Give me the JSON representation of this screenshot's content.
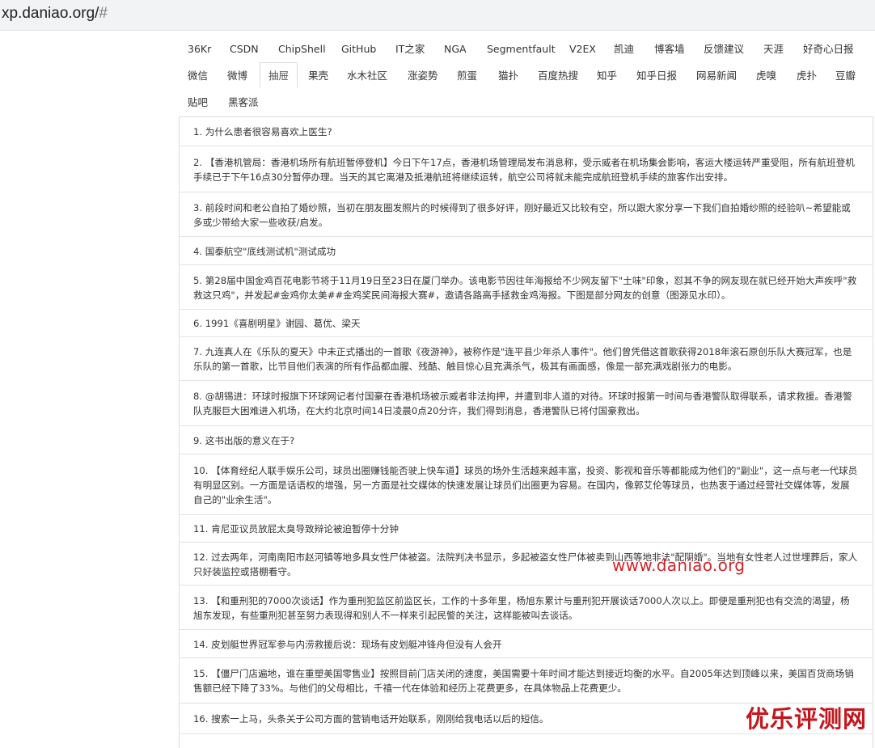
{
  "browser": {
    "url": "xp.daniao.org/",
    "url_hash": "#"
  },
  "tabs_row1": [
    "36Kr",
    "CSDN",
    "ChipShell",
    "GitHub",
    "IT之家",
    "NGA",
    "Segmentfault",
    "V2EX",
    "凯迪",
    "博客墙",
    "反馈建议",
    "天涯",
    "好奇心日报"
  ],
  "tabs_row2": [
    "微信",
    "微博",
    "抽屉",
    "果壳",
    "水木社区",
    "涨姿势",
    "煎蛋",
    "猫扑",
    "百度热搜",
    "知乎",
    "知乎日报",
    "网易新闻",
    "虎嗅",
    "虎扑",
    "豆瓣"
  ],
  "tabs_row3": [
    "贴吧",
    "黑客派"
  ],
  "active_tab": "抽屉",
  "items": [
    "1. 为什么患者很容易喜欢上医生?",
    "2. 【香港机管局：香港机场所有航班暂停登机】今日下午17点，香港机场管理局发布消息称，受示威者在机场集会影响，客运大楼运转严重受阻，所有航班登机手续已于下午16点30分暂停办理。当天的其它离港及抵港航班将继续运转，航空公司将就未能完成航班登机手续的旅客作出安排。",
    "3. 前段时间和老公自拍了婚纱照，当初在朋友圈发照片的时候得到了很多好评，刚好最近又比较有空，所以跟大家分享一下我们自拍婚纱照的经验叭~希望能或多或少带给大家一些收获/启发。",
    "4. 国泰航空\"底线测试机\"测试成功",
    "5. 第28届中国金鸡百花电影节将于11月19日至23日在厦门举办。该电影节因往年海报给不少网友留下\"土味\"印象，怼其不争的网友现在就已经开始大声疾呼\"救救这只鸡\"，并发起#金鸡你太美##金鸡奖民间海报大赛#，邀请各路高手拯救金鸡海报。下图是部分网友的创意（图源见水印）。",
    "6. 1991《喜剧明星》谢园、葛优、梁天",
    "7. 九连真人在《乐队的夏天》中未正式播出的一首歌《夜游神》，被称作是\"连平县少年杀人事件\"。他们曾凭借这首歌获得2018年滚石原创乐队大赛冠军，也是乐队的第一首歌，比节目他们表演的所有作品都血腥、残酷、触目惊心且充满杀气，极其有画面感，像是一部充满戏剧张力的电影。",
    "8. @胡锡进：环球时报旗下环球网记者付国豪在香港机场被示威者非法拘押，并遭到非人道的对待。环球时报第一时间与香港警队取得联系，请求救援。香港警队克服巨大困难进入机场，在大约北京时间14日凌晨0点20分许，我们得到消息，香港警队已将付国豪救出。",
    "9. 这书出版的意义在于?",
    "10. 【体育经纪人联手娱乐公司，球员出圈赚钱能否驶上快车道】球员的场外生活越来越丰富，投资、影视和音乐等都能成为他们的\"副业\"，这一点与老一代球员有明显区别。一方面是话语权的增强，另一方面是社交媒体的快速发展让球员们出圈更为容易。在国内，像郭艾伦等球员，也热衷于通过经营社交媒体等，发展自己的\"业余生活\"。",
    "11. 肯尼亚议员放屁太臭导致辩论被迫暂停十分钟",
    "12. 过去两年，河南南阳市赵河镇等地多具女性尸体被盗。法院判决书显示，多起被盗女性尸体被卖到山西等地非法\"配阴婚\"。当地有女性老人过世埋葬后，家人只好装监控或搭棚看守。",
    "13. 【和重刑犯的7000次谈话】作为重刑犯监区前监区长，工作的十多年里，杨旭东累计与重刑犯开展谈话7000人次以上。即便是重刑犯也有交流的渴望，杨旭东发现，有些重刑犯甚至努力表现得和别人不一样来引起民警的关注，这样能被叫去谈话。",
    "14. 皮划艇世界冠军参与内涝救援后说：现场有皮划艇冲锋舟但没有人会开",
    "15. 【僵尸门店遍地，谁在重塑美国零售业】按照目前门店关闭的速度，美国需要十年时间才能达到接近均衡的水平。自2005年达到顶峰以来，美国百货商场销售额已经下降了33%。与他们的父母相比，千禧一代在体验和经历上花费更多，在具体物品上花费更少。",
    "16. 搜索一上马，头条关于公司方面的营销电话开始联系，刚刚给我电话以后的短信。"
  ],
  "watermark": {
    "site": "www.daniao.org",
    "brand": "优乐评测网"
  }
}
